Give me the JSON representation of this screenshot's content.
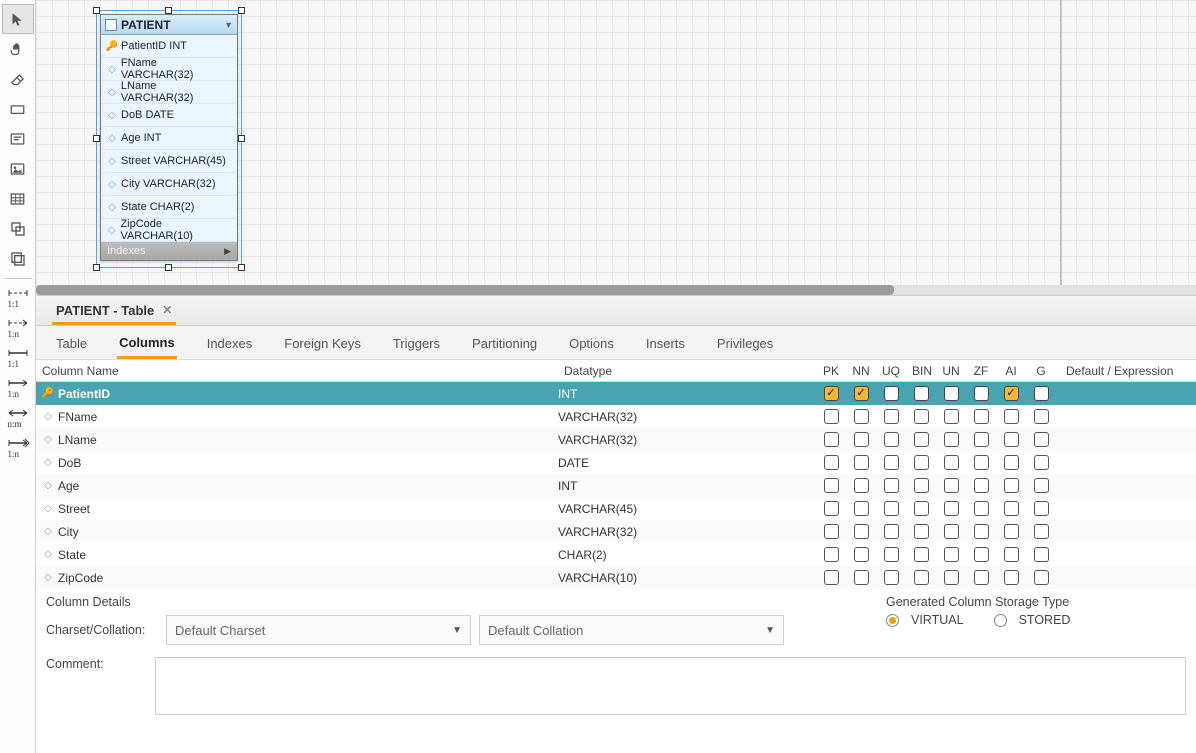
{
  "entity": {
    "name": "PATIENT",
    "footer": "Indexes",
    "columns": [
      {
        "label": "PatientID INT",
        "pk": true
      },
      {
        "label": "FName VARCHAR(32)",
        "pk": false
      },
      {
        "label": "LName VARCHAR(32)",
        "pk": false
      },
      {
        "label": "DoB DATE",
        "pk": false
      },
      {
        "label": "Age INT",
        "pk": false
      },
      {
        "label": "Street VARCHAR(45)",
        "pk": false
      },
      {
        "label": "City VARCHAR(32)",
        "pk": false
      },
      {
        "label": "State CHAR(2)",
        "pk": false
      },
      {
        "label": "ZipCode VARCHAR(10)",
        "pk": false
      }
    ]
  },
  "editor_tab": {
    "title": "PATIENT - Table"
  },
  "subtabs": [
    "Table",
    "Columns",
    "Indexes",
    "Foreign Keys",
    "Triggers",
    "Partitioning",
    "Options",
    "Inserts",
    "Privileges"
  ],
  "subtab_active": "Columns",
  "grid_headers": {
    "name": "Column Name",
    "dtype": "Datatype",
    "flags": [
      "PK",
      "NN",
      "UQ",
      "BIN",
      "UN",
      "ZF",
      "AI",
      "G"
    ],
    "default": "Default / Expression"
  },
  "rows": [
    {
      "name": "PatientID",
      "dtype": "INT",
      "pk": true,
      "flags": [
        true,
        true,
        false,
        false,
        false,
        false,
        true,
        false
      ],
      "selected": true
    },
    {
      "name": "FName",
      "dtype": "VARCHAR(32)",
      "pk": false,
      "flags": [
        false,
        false,
        false,
        false,
        false,
        false,
        false,
        false
      ],
      "selected": false
    },
    {
      "name": "LName",
      "dtype": "VARCHAR(32)",
      "pk": false,
      "flags": [
        false,
        false,
        false,
        false,
        false,
        false,
        false,
        false
      ],
      "selected": false
    },
    {
      "name": "DoB",
      "dtype": "DATE",
      "pk": false,
      "flags": [
        false,
        false,
        false,
        false,
        false,
        false,
        false,
        false
      ],
      "selected": false
    },
    {
      "name": "Age",
      "dtype": "INT",
      "pk": false,
      "flags": [
        false,
        false,
        false,
        false,
        false,
        false,
        false,
        false
      ],
      "selected": false
    },
    {
      "name": "Street",
      "dtype": "VARCHAR(45)",
      "pk": false,
      "flags": [
        false,
        false,
        false,
        false,
        false,
        false,
        false,
        false
      ],
      "selected": false
    },
    {
      "name": "City",
      "dtype": "VARCHAR(32)",
      "pk": false,
      "flags": [
        false,
        false,
        false,
        false,
        false,
        false,
        false,
        false
      ],
      "selected": false
    },
    {
      "name": "State",
      "dtype": "CHAR(2)",
      "pk": false,
      "flags": [
        false,
        false,
        false,
        false,
        false,
        false,
        false,
        false
      ],
      "selected": false
    },
    {
      "name": "ZipCode",
      "dtype": "VARCHAR(10)",
      "pk": false,
      "flags": [
        false,
        false,
        false,
        false,
        false,
        false,
        false,
        false
      ],
      "selected": false
    }
  ],
  "details": {
    "column_details_label": "Column Details",
    "charset_label": "Charset/Collation:",
    "charset_value": "Default Charset",
    "collation_value": "Default Collation",
    "storage_label": "Generated Column Storage Type",
    "virtual_label": "VIRTUAL",
    "stored_label": "STORED",
    "storage_selected": "VIRTUAL",
    "comment_label": "Comment:"
  },
  "toolbar_rel_labels": [
    "1:1",
    "1:n",
    "1:1",
    "1:n",
    "n:m",
    "1:n"
  ]
}
